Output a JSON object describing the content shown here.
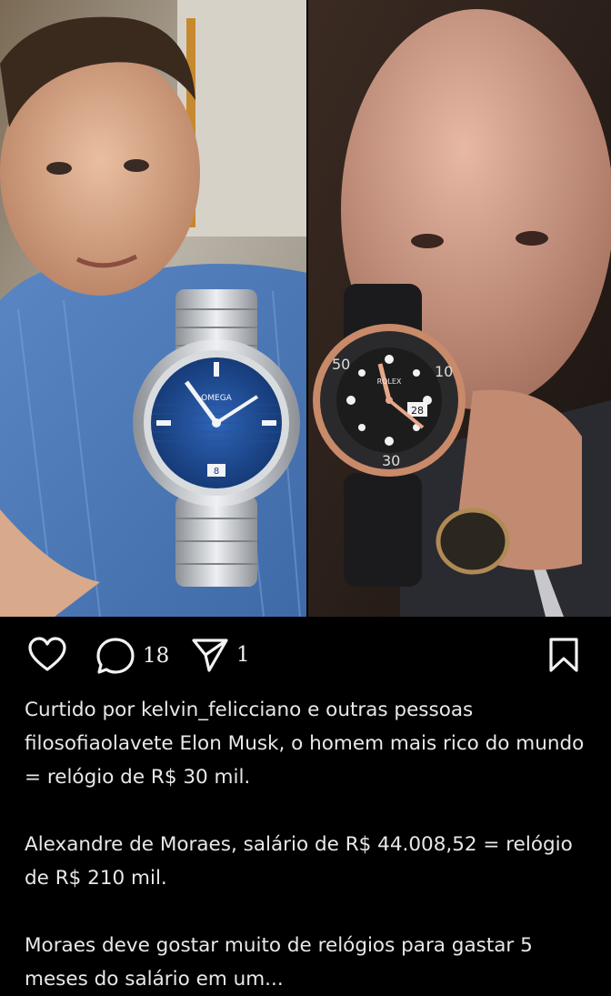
{
  "post": {
    "image_alt": "Photo collage: man with Omega Seamaster watch, man with Rolex Yacht-Master watch",
    "left_watch_brand": "OMEGA",
    "right_watch_brand": "ROLEX",
    "right_watch_date": "28",
    "left_watch_date": "8",
    "bezel_numbers": [
      "50",
      "10",
      "30"
    ]
  },
  "actions": {
    "like_icon": "heart-icon",
    "comment_icon": "comment-icon",
    "comment_count": "18",
    "share_icon": "send-icon",
    "share_count": "1",
    "save_icon": "bookmark-icon"
  },
  "caption": {
    "liked_by": "Curtido por kelvin_felicciano e outras pessoas",
    "username": "filosofiaolavete",
    "line1_text": " Elon Musk, o homem mais rico do mundo = relógio de R$ 30 mil.",
    "paragraph2": "Alexandre de Moraes, salário de R$ 44.008,52 = relógio de R$ 210 mil.",
    "paragraph3": "Moraes deve gostar muito de relógios para gastar 5 meses do salário em um..."
  },
  "colors": {
    "background": "#000000",
    "text": "#e8e8e8",
    "omega_dial": "#1e4f9c",
    "rolex_dial": "#1c1c1c",
    "rose_gold": "#c98a6a"
  }
}
